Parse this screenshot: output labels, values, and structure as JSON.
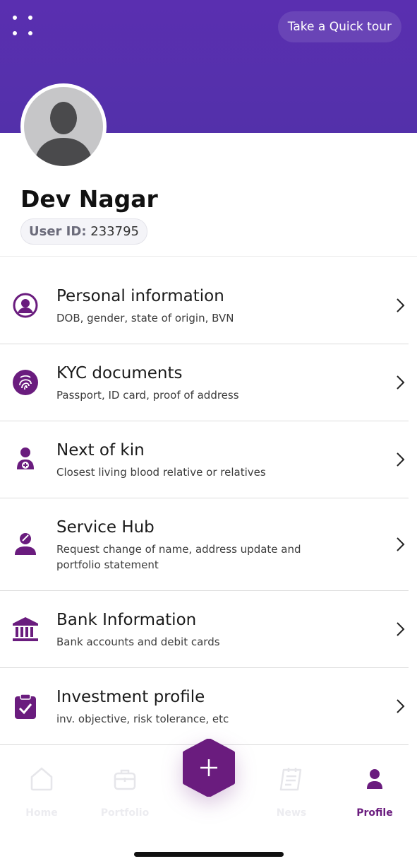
{
  "header": {
    "quick_tour_label": "Take a Quick tour",
    "accent_color": "#5a2fb0"
  },
  "profile": {
    "name": "Dev Nagar",
    "user_id_label": "User ID:",
    "user_id_value": "233795"
  },
  "menu_items": [
    {
      "title": "Personal information",
      "description": "DOB, gender, state of origin, BVN",
      "icon": "user-circle-icon"
    },
    {
      "title": "KYC documents",
      "description": "Passport, ID card, proof of address",
      "icon": "fingerprint-icon"
    },
    {
      "title": "Next of kin",
      "description": "Closest living blood relative or relatives",
      "icon": "person-plus-icon"
    },
    {
      "title": "Service Hub",
      "description": "Request change of name, address update and portfolio statement",
      "icon": "person-edit-icon"
    },
    {
      "title": "Bank Information",
      "description": "Bank accounts and debit cards",
      "icon": "bank-icon"
    },
    {
      "title": "Investment profile",
      "description": "inv. objective, risk tolerance, etc",
      "icon": "clipboard-check-icon"
    }
  ],
  "bottom_nav": {
    "items": [
      {
        "label": "Home",
        "icon": "home-icon",
        "active": false
      },
      {
        "label": "Portfolio",
        "icon": "briefcase-icon",
        "active": false
      },
      {
        "label": "News",
        "icon": "newspaper-icon",
        "active": false
      },
      {
        "label": "Profile",
        "icon": "profile-icon",
        "active": true
      }
    ],
    "fab_icon": "plus-icon",
    "active_color": "#6a1c7e"
  }
}
